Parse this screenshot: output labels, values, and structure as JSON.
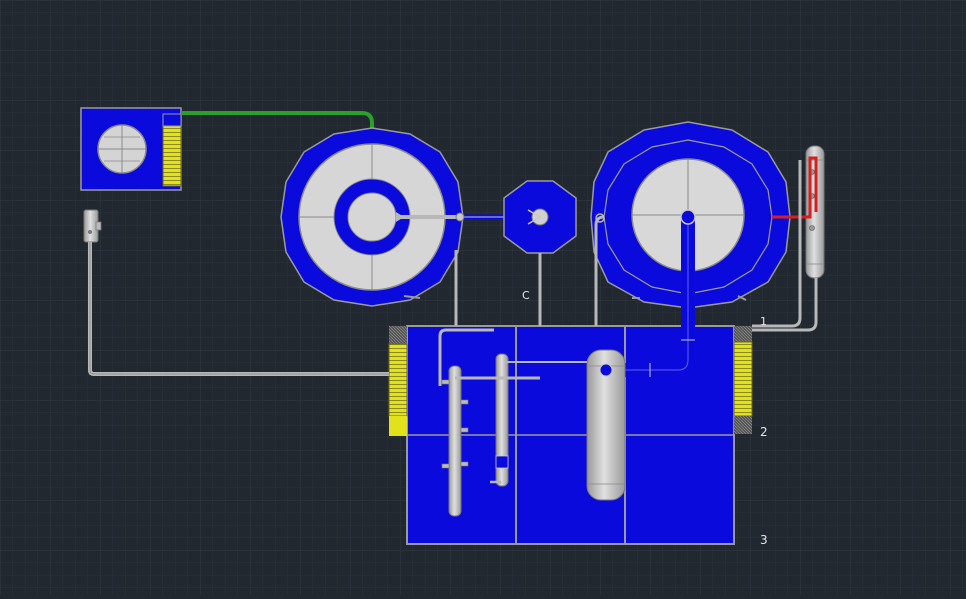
{
  "canvas": {
    "background": "#212830",
    "grid_minor": "#2a323b",
    "grid_major": "#323a44"
  },
  "colors": {
    "equipment_blue": "#0a0adc",
    "steel": "#c8c8c8",
    "steel_dark": "#8a8a8a",
    "green_line": "#2aa02a",
    "red_line": "#d42020",
    "yellow_fins": "#e2e21c",
    "label": "#e6e6e6"
  },
  "labels": {
    "c": "C",
    "one": "1",
    "two": "2",
    "three": "3"
  }
}
